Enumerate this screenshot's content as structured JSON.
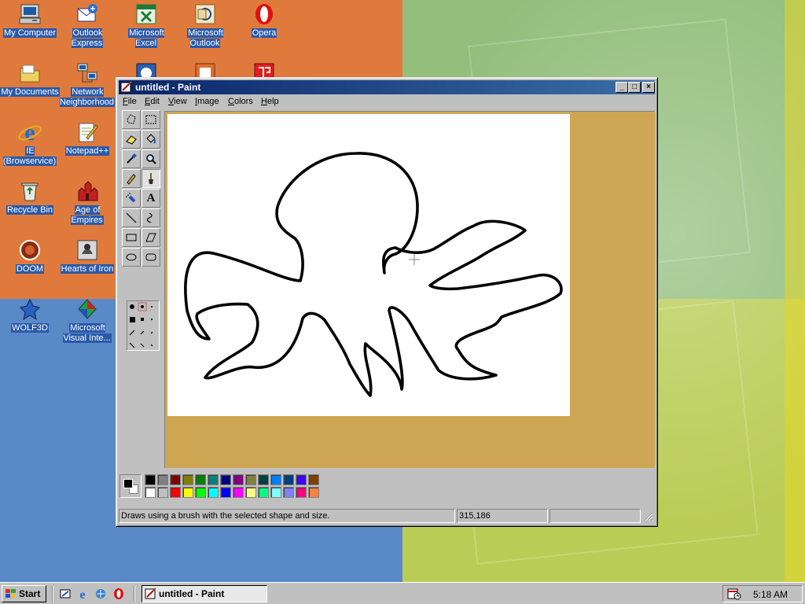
{
  "desktop": {
    "icons": [
      {
        "label": "My Computer",
        "icon": "computer-icon"
      },
      {
        "label": "Outlook Express",
        "icon": "outlook-express-icon"
      },
      {
        "label": "Microsoft Excel",
        "icon": "excel-icon"
      },
      {
        "label": "Microsoft Outlook",
        "icon": "outlook-icon"
      },
      {
        "label": "Opera",
        "icon": "opera-icon"
      },
      {
        "label": "My Documents",
        "icon": "folder-icon"
      },
      {
        "label": "Network Neighborhood",
        "icon": "network-icon"
      },
      {
        "label": "IE (Browservice)",
        "icon": "internet-explorer-icon"
      },
      {
        "label": "Notepad++",
        "icon": "notepad-icon"
      },
      {
        "label": "Recycle Bin",
        "icon": "recycle-bin-icon"
      },
      {
        "label": "Age of Empires",
        "icon": "age-of-empires-icon"
      },
      {
        "label": "DOOM",
        "icon": "doom-icon"
      },
      {
        "label": "Hearts of Iron",
        "icon": "hearts-of-iron-icon"
      },
      {
        "label": "WOLF3D",
        "icon": "wolf3d-icon"
      },
      {
        "label": "Microsoft Visual Inte...",
        "icon": "visual-interdev-icon"
      }
    ]
  },
  "window": {
    "title": "untitled - Paint",
    "controls": {
      "minimize": "_",
      "maximize": "□",
      "close": "×"
    },
    "menu": [
      {
        "hotkey": "F",
        "rest": "ile"
      },
      {
        "hotkey": "E",
        "rest": "dit"
      },
      {
        "hotkey": "V",
        "rest": "iew"
      },
      {
        "hotkey": "I",
        "rest": "mage"
      },
      {
        "hotkey": "C",
        "rest": "olors"
      },
      {
        "hotkey": "H",
        "rest": "elp"
      }
    ],
    "tools": [
      "free-form-select-icon",
      "rectangle-select-icon",
      "eraser-icon",
      "fill-bucket-icon",
      "color-picker-icon",
      "magnifier-icon",
      "pencil-icon",
      "brush-icon",
      "airbrush-icon",
      "text-icon",
      "line-icon",
      "curve-icon",
      "rectangle-icon",
      "polygon-icon",
      "ellipse-icon",
      "rounded-rectangle-icon"
    ],
    "active_tool": "brush-icon",
    "text_tool_glyph": "A",
    "colors": {
      "foreground": "#000000",
      "background": "#ffffff",
      "workspace": "#cfa654",
      "title_gradient_start": "#0a246a",
      "title_gradient_end": "#3a6ea5"
    },
    "palette": {
      "row1": [
        "#000000",
        "#808080",
        "#800000",
        "#808000",
        "#008000",
        "#008080",
        "#000080",
        "#800080",
        "#808040",
        "#004040",
        "#0080ff",
        "#004080",
        "#4000ff",
        "#804000"
      ],
      "row2": [
        "#ffffff",
        "#c0c0c0",
        "#ff0000",
        "#ffff00",
        "#00ff00",
        "#00ffff",
        "#0000ff",
        "#ff00ff",
        "#ffff80",
        "#00ff80",
        "#80ffff",
        "#8080ff",
        "#ff0080",
        "#ff8040"
      ]
    },
    "status": {
      "message": "Draws using a brush with the selected shape and size.",
      "coords": "315,186",
      "size": ""
    }
  },
  "taskbar": {
    "start_label": "Start",
    "quick_launch": [
      "show-desktop-icon",
      "internet-explorer-icon",
      "channels-icon",
      "opera-icon"
    ],
    "task_label": "untitled - Paint",
    "clock": "5:18 AM",
    "tray_icons": [
      "scheduler-icon"
    ]
  }
}
